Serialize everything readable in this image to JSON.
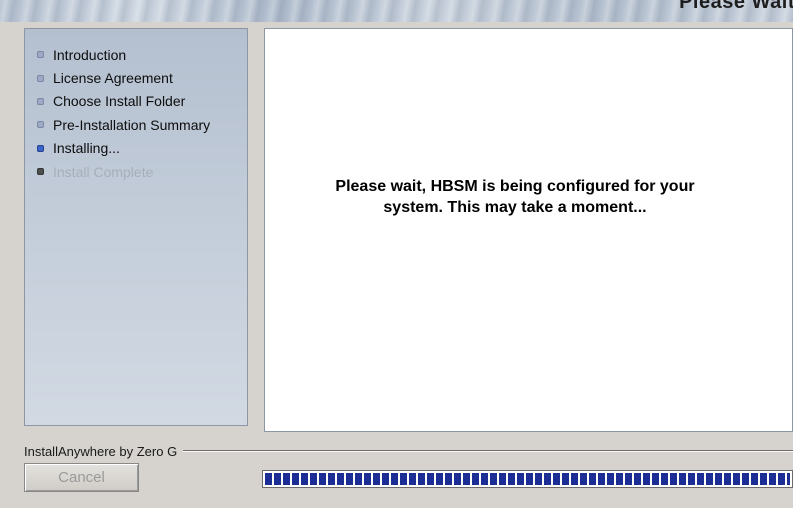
{
  "header": {
    "title": "Please Wait"
  },
  "sidebar": {
    "steps": [
      {
        "label": "Introduction",
        "state": "done"
      },
      {
        "label": "License Agreement",
        "state": "done"
      },
      {
        "label": "Choose Install Folder",
        "state": "done"
      },
      {
        "label": "Pre-Installation Summary",
        "state": "done"
      },
      {
        "label": "Installing...",
        "state": "current"
      },
      {
        "label": "Install Complete",
        "state": "pending"
      }
    ]
  },
  "main": {
    "message_line1": "Please wait,  HBSM is being configured for your",
    "message_line2": "system. This may take a moment..."
  },
  "footer": {
    "brand": "InstallAnywhere by Zero G",
    "cancel_label": "Cancel",
    "progress_fraction": 1.0
  },
  "colors": {
    "progress_block": "#1d2d96",
    "current_step_bullet": "#3c63c9",
    "done_step_bullet": "#9ea9c6"
  }
}
